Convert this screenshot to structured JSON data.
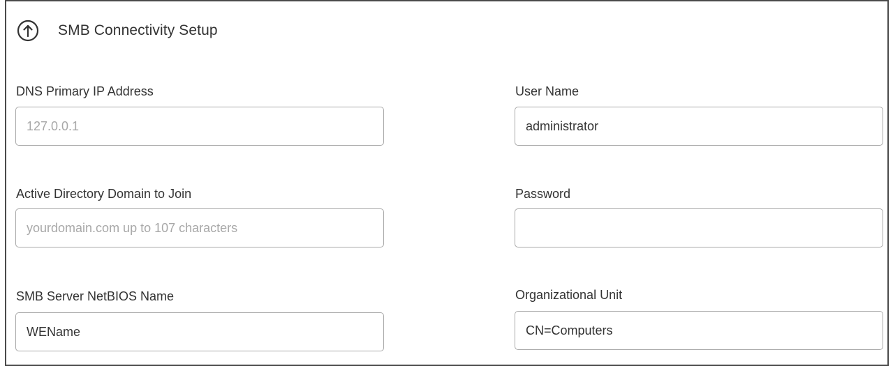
{
  "header": {
    "title": "SMB Connectivity Setup",
    "collapse_icon": "arrow-up-circle-icon"
  },
  "fields": {
    "dns_primary_ip": {
      "label": "DNS Primary IP Address",
      "value": "",
      "placeholder": "127.0.0.1"
    },
    "ad_domain": {
      "label": "Active Directory Domain to Join",
      "value": "",
      "placeholder": "yourdomain.com up to 107 characters"
    },
    "netbios_name": {
      "label": "SMB Server NetBIOS Name",
      "value": "WEName",
      "placeholder": ""
    },
    "user_name": {
      "label": "User Name",
      "value": "administrator",
      "placeholder": ""
    },
    "password": {
      "label": "Password",
      "value": "",
      "placeholder": ""
    },
    "organizational_unit": {
      "label": "Organizational Unit",
      "value": "CN=Computers",
      "placeholder": ""
    }
  },
  "colors": {
    "border": "#a9a9a9",
    "text": "#333333",
    "placeholder": "#a8a8a8",
    "panel_border": "#4a4a4a"
  }
}
